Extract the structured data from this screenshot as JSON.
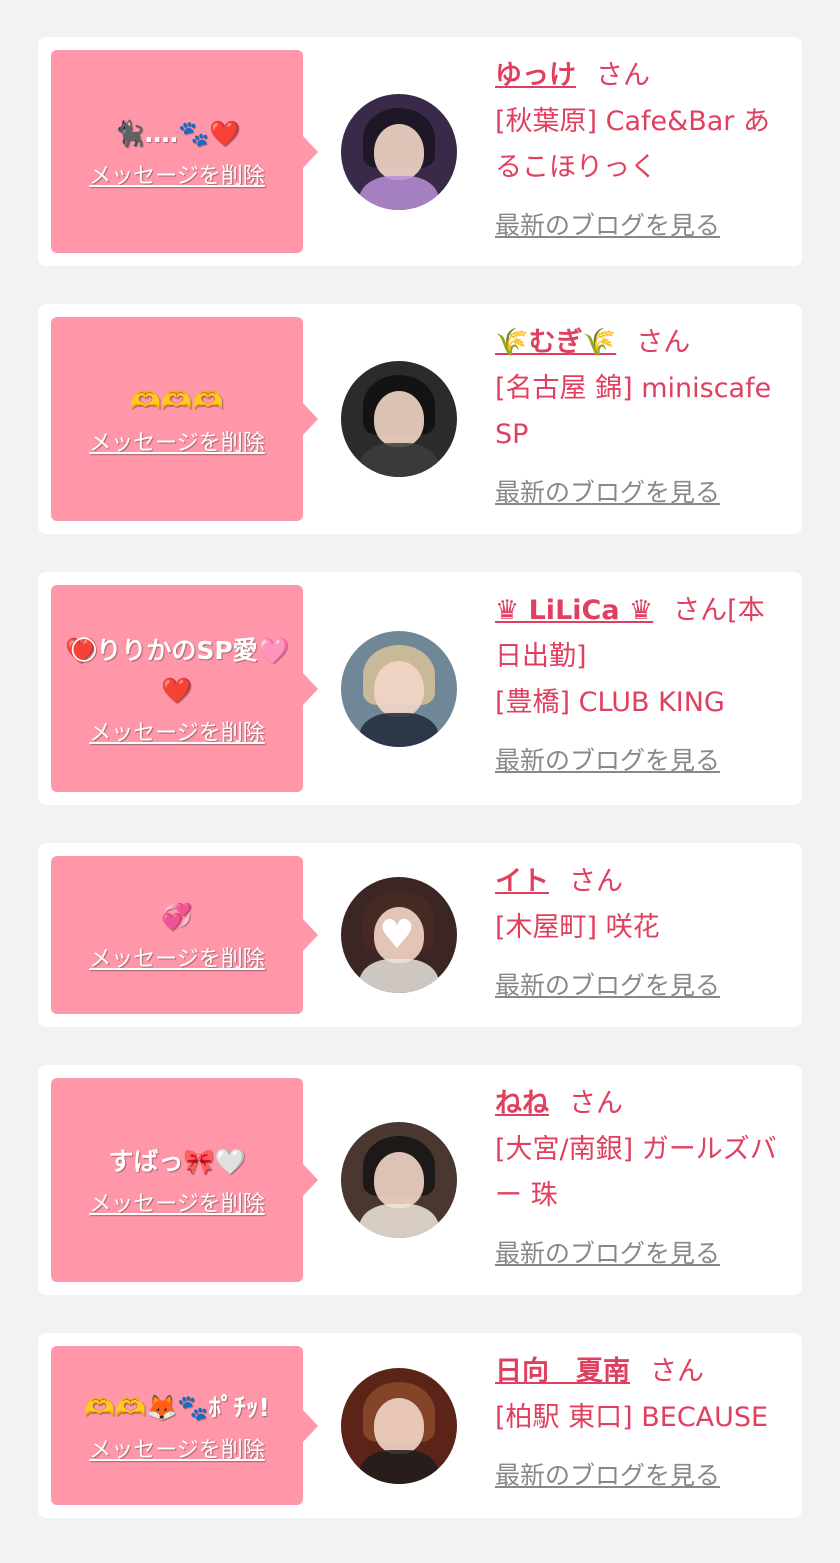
{
  "san": "さん",
  "delete_label": "メッセージを削除",
  "blog_label": "最新のブログを見る",
  "cards": [
    {
      "message": "🐈‍⬛‥‥🐾❤️",
      "name": "ゆっけ",
      "suffix": "",
      "shop": "[秋葉原] Cafe&Bar あるこほりっく",
      "avatar_colors": {
        "bg": "#3a2a4a",
        "hair": "#1a1420",
        "body": "#b78fd6"
      }
    },
    {
      "message": "🫶🫶🫶",
      "name": "🌾むぎ🌾",
      "suffix": "",
      "shop": "[名古屋 錦] miniscafe SP",
      "avatar_colors": {
        "bg": "#2b2b2b",
        "hair": "#0f0f0f",
        "body": "#3d3d3d"
      }
    },
    {
      "message": "❤️⃝りりかのSP愛🩷❤️",
      "name": "♛ LiLiCa ♛",
      "suffix": "[本日出勤]",
      "shop": "[豊橋] CLUB KING",
      "avatar_colors": {
        "bg": "#6f8796",
        "hair": "#d9c29a",
        "body": "#1f2a3a"
      }
    },
    {
      "message": "💞",
      "name": "イト",
      "suffix": "",
      "shop": "[木屋町] 咲花",
      "avatar_colors": {
        "bg": "#3b2624",
        "hair": "#4a2a24",
        "body": "#e9e3dd"
      },
      "face_hidden": true
    },
    {
      "message": "すばっ🎀🤍",
      "name": "ねね",
      "suffix": "",
      "shop": "[大宮/南銀] ガールズバー 珠",
      "avatar_colors": {
        "bg": "#4a3830",
        "hair": "#141414",
        "body": "#efe6dc"
      }
    },
    {
      "message": "🫶🫶🦊🐾ﾎﾟﾁｯ!",
      "name": "日向　夏南",
      "suffix": "",
      "shop": "[柏駅 東口] BECAUSE",
      "avatar_colors": {
        "bg": "#5c2418",
        "hair": "#8a4a2a",
        "body": "#1d1d1d"
      }
    }
  ]
}
